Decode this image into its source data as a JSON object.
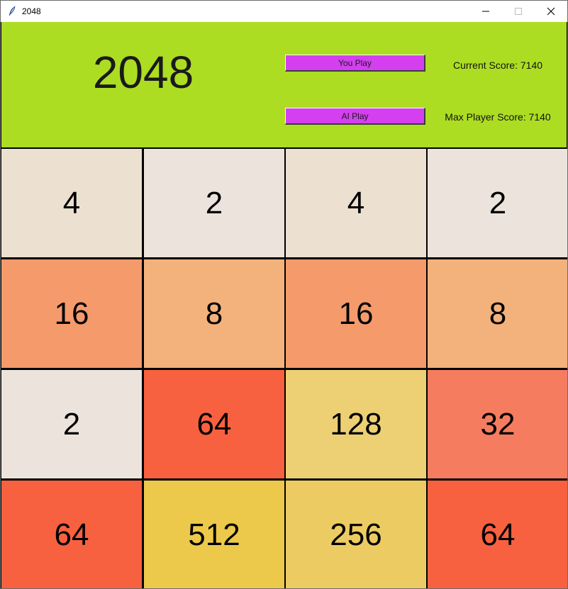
{
  "window": {
    "title": "2048",
    "icon": "feather-icon"
  },
  "header": {
    "title": "2048",
    "background": "#acdd22",
    "you_play_label": "You Play",
    "ai_play_label": "AI Play",
    "button_color": "#d43ff0",
    "current_score_text": "Current Score: 7140",
    "max_score_text": "Max Player Score: 7140"
  },
  "board": {
    "rows": [
      [
        {
          "value": "4",
          "color": "#ece0d1"
        },
        {
          "value": "2",
          "color": "#ece4dc"
        },
        {
          "value": "4",
          "color": "#ece0d1"
        },
        {
          "value": "2",
          "color": "#ece4dc"
        }
      ],
      [
        {
          "value": "16",
          "color": "#f59a6b"
        },
        {
          "value": "8",
          "color": "#f3b27b"
        },
        {
          "value": "16",
          "color": "#f59a6b"
        },
        {
          "value": "8",
          "color": "#f3b27b"
        }
      ],
      [
        {
          "value": "2",
          "color": "#ece4dc"
        },
        {
          "value": "64",
          "color": "#f7613f"
        },
        {
          "value": "128",
          "color": "#ecd073"
        },
        {
          "value": "32",
          "color": "#f67c5f"
        }
      ],
      [
        {
          "value": "64",
          "color": "#f7613f"
        },
        {
          "value": "512",
          "color": "#ecc94a"
        },
        {
          "value": "256",
          "color": "#eccc62"
        },
        {
          "value": "64",
          "color": "#f7613f"
        }
      ]
    ]
  }
}
